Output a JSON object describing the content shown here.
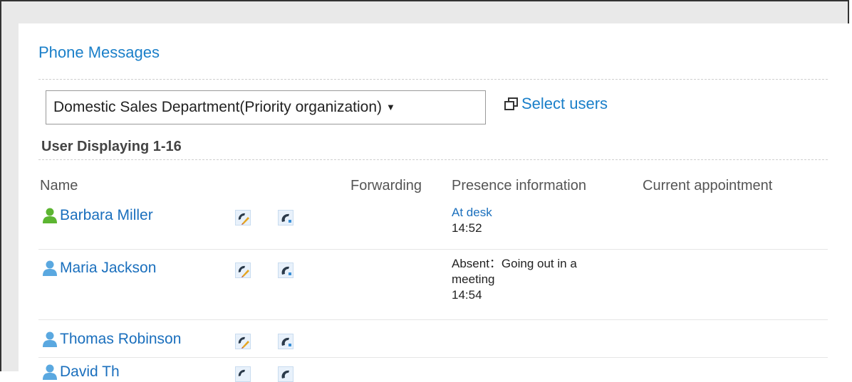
{
  "page": {
    "title": "Phone Messages",
    "organization_select": "Domestic Sales Department(Priority organization)",
    "select_users_label": "Select users",
    "displaying_label": "User Displaying 1-16"
  },
  "columns": {
    "name": "Name",
    "forwarding": "Forwarding",
    "presence": "Presence information",
    "appointment": "Current appointment"
  },
  "users": [
    {
      "name": "Barbara Miller",
      "presence_status": "At desk",
      "presence_time": "14:52",
      "icon_color": "#5cb531"
    },
    {
      "name": "Maria Jackson",
      "presence_status": "Absent：Going out in a",
      "presence_status2": "meeting",
      "presence_time": "14:54",
      "icon_color": "#5aa8e0"
    },
    {
      "name": "Thomas Robinson",
      "icon_color": "#5aa8e0"
    },
    {
      "name": "David Th",
      "icon_color": "#5aa8e0"
    }
  ]
}
